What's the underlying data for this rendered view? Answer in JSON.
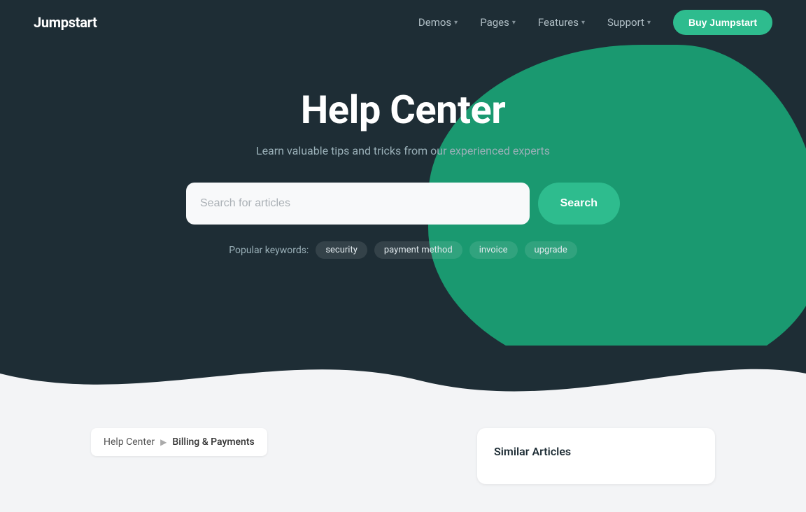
{
  "navbar": {
    "logo": "Jumpstart",
    "nav_items": [
      {
        "label": "Demos",
        "has_dropdown": true
      },
      {
        "label": "Pages",
        "has_dropdown": true
      },
      {
        "label": "Features",
        "has_dropdown": true
      },
      {
        "label": "Support",
        "has_dropdown": true
      }
    ],
    "cta_label": "Buy Jumpstart"
  },
  "hero": {
    "title": "Help Center",
    "subtitle": "Learn valuable tips and tricks from our experienced experts",
    "search_placeholder": "Search for articles",
    "search_button_label": "Search",
    "popular_keywords_label": "Popular keywords:",
    "keywords": [
      "security",
      "payment method",
      "invoice",
      "upgrade"
    ]
  },
  "breadcrumb": {
    "home": "Help Center",
    "current": "Billing & Payments"
  },
  "sidebar": {
    "title": "Similar Articles"
  }
}
